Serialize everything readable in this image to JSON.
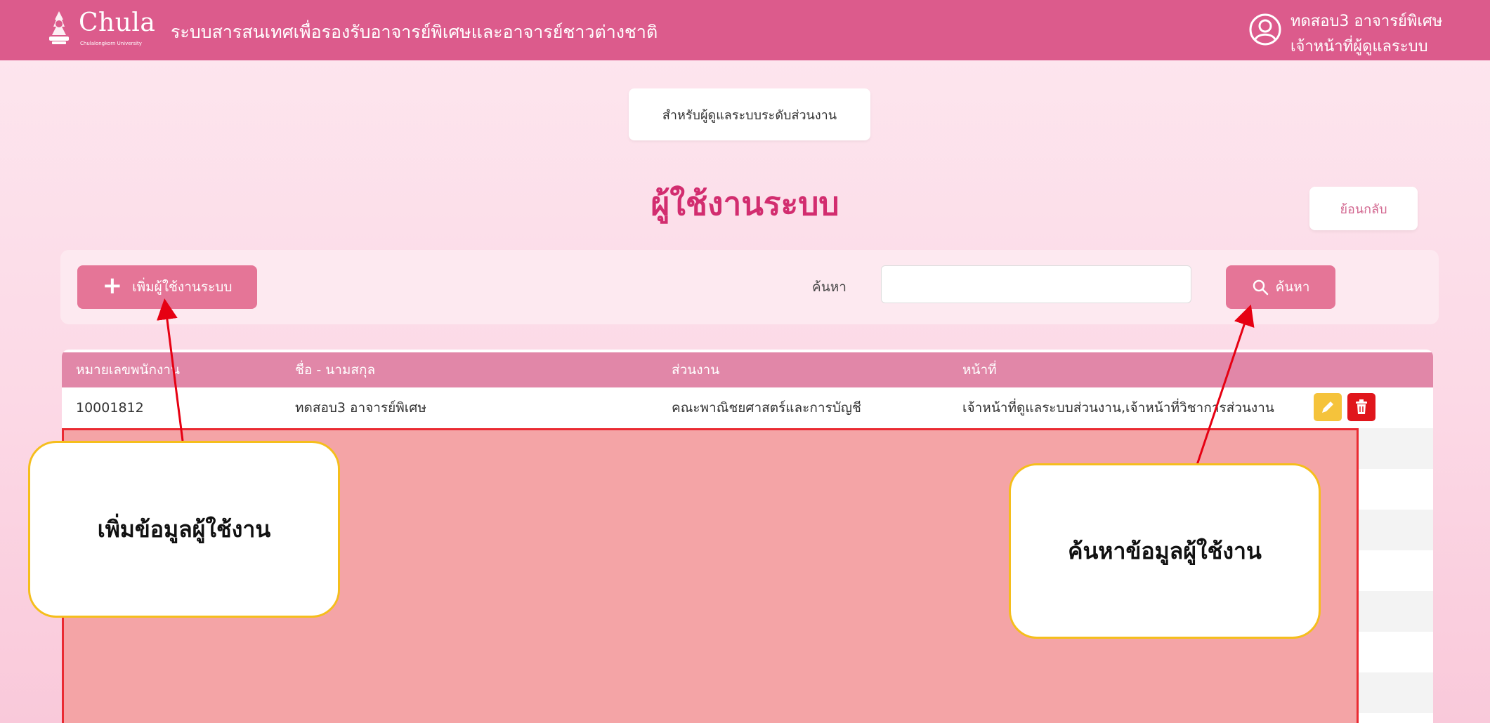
{
  "header": {
    "logo_text": "Chula",
    "logo_subtext": "Chulalongkorn University",
    "system_title": "ระบบสารสนเทศเพื่อรองรับอาจารย์พิเศษและอาจารย์ชาวต่างชาติ",
    "user_name": "ทดสอบ3 อาจารย์พิเศษ",
    "user_role": "เจ้าหน้าที่ผู้ดูแลระบบ",
    "user_icon": "user-circle-icon",
    "bg_color": "#dc5b8c"
  },
  "admin_chip": "สำหรับผู้ดูแลระบบระดับส่วนงาน",
  "page_title": "ผู้ใช้งานระบบ",
  "back_button": "ย้อนกลับ",
  "toolbar": {
    "add_button": "เพิ่มผู้ใช้งานระบบ",
    "add_icon": "plus-icon",
    "search_label": "ค้นหา",
    "search_value": "",
    "search_button": "ค้นหา",
    "search_icon": "search-icon"
  },
  "table": {
    "headers": [
      "หมายเลขพนักงาน",
      "ชื่อ - นามสกุล",
      "ส่วนงาน",
      "หน้าที่"
    ],
    "rows": [
      [
        "10001812",
        "ทดสอบ3 อาจารย์พิเศษ",
        "คณะพาณิชยศาสตร์และการบัญชี",
        "เจ้าหน้าที่ดูแลระบบส่วนงาน,เจ้าหน้าที่วิชาการส่วนงาน"
      ]
    ],
    "row_actions": [
      "pencil-icon",
      "trash-icon"
    ]
  },
  "annotations": {
    "add_callout": "เพิ่มข้อมูลผู้ใช้งาน",
    "search_callout": "ค้นหาข้อมูลผู้ใช้งาน"
  },
  "colors": {
    "accent": "#e57597",
    "title": "#d22d6f",
    "edit": "#f5c33b",
    "delete": "#e0161c",
    "mask": "#f4a4a6",
    "callout_border": "#f5be1c"
  }
}
